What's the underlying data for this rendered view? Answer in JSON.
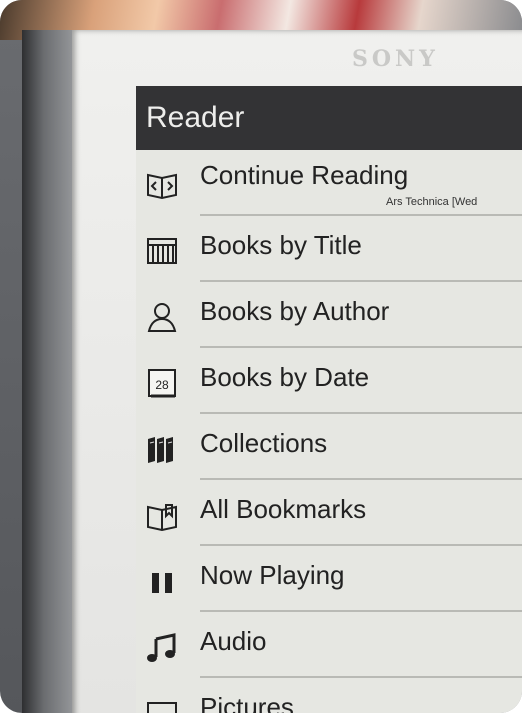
{
  "device": {
    "brand": "SONY"
  },
  "header": {
    "title": "Reader"
  },
  "menu": [
    {
      "label": "Continue Reading",
      "subtitle": "Ars Technica [Wed",
      "icon": "open-book-icon"
    },
    {
      "label": "Books by Title",
      "icon": "bookshelf-icon"
    },
    {
      "label": "Books by Author",
      "icon": "person-icon"
    },
    {
      "label": "Books by Date",
      "icon": "calendar-icon",
      "icon_text": "28"
    },
    {
      "label": "Collections",
      "icon": "books-collection-icon"
    },
    {
      "label": "All Bookmarks",
      "icon": "bookmark-book-icon"
    },
    {
      "label": "Now Playing",
      "icon": "pause-icon"
    },
    {
      "label": "Audio",
      "icon": "music-note-icon"
    },
    {
      "label": "Pictures",
      "icon": "picture-icon"
    }
  ]
}
